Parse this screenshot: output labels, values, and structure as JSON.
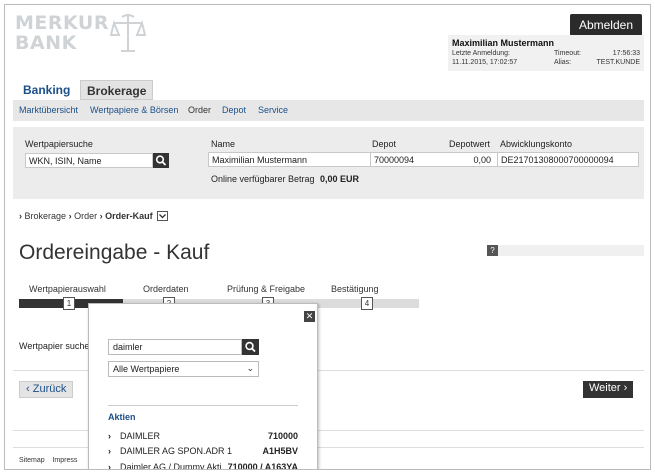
{
  "header": {
    "logo_line1": "MERKUR",
    "logo_line2": "BANK",
    "logout_label": "Abmelden",
    "user": {
      "name": "Maximilian Mustermann",
      "last_login_label": "Letzte Anmeldung:",
      "last_login_value": "11.11.2015, 17:02:57",
      "timeout_label": "Timeout:",
      "timeout_value": "17:56:33",
      "alias_label": "Alias:",
      "alias_value": "TEST.KUNDE"
    }
  },
  "nav": {
    "tabs": [
      {
        "label": "Banking",
        "active": false
      },
      {
        "label": "Brokerage",
        "active": true
      }
    ],
    "subnav": [
      "Marktübersicht",
      "Wertpapiere & Börsen",
      "Order",
      "Depot",
      "Service"
    ]
  },
  "search_panel": {
    "search_label": "Wertpapiersuche",
    "search_placeholder": "WKN, ISIN, Name",
    "col_name": "Name",
    "col_depot": "Depot",
    "col_depotwert": "Depotwert",
    "col_abwicklung": "Abwicklungskonto",
    "name_value": "Maximilian Mustermann",
    "depot_value": "70000094",
    "depotwert_value": "0,00",
    "abwicklung_value": "DE21701308000700000094",
    "available_label": "Online verfügbarer Betrag",
    "available_value": "0,00 EUR"
  },
  "breadcrumb": [
    "Brokerage",
    "Order",
    "Order-Kauf"
  ],
  "page_title": "Ordereingabe - Kauf",
  "help_label": "?",
  "steps": [
    {
      "label": "Wertpapierauswahl",
      "num": "1"
    },
    {
      "label": "Orderdaten",
      "num": "2"
    },
    {
      "label": "Prüfung & Freigabe",
      "num": "3"
    },
    {
      "label": "Bestätigung",
      "num": "4"
    }
  ],
  "step_progress": 0.25,
  "side_label": "Wertpapier suche",
  "back_label": "Zurück",
  "next_label": "Weiter",
  "footer": {
    "sitemap": "Sitemap",
    "impressum": "Impress"
  },
  "popup": {
    "search_value": "daimler",
    "filter_value": "Alle Wertpapiere",
    "section_heading": "Aktien",
    "results": [
      {
        "name": "DAIMLER",
        "wkn": "710000"
      },
      {
        "name": "DAIMLER AG SPON.ADR 1",
        "wkn": "A1H5BV"
      },
      {
        "name": "Daimler AG / Dummy Akti",
        "wkn": "710000 / A163YA"
      }
    ]
  }
}
